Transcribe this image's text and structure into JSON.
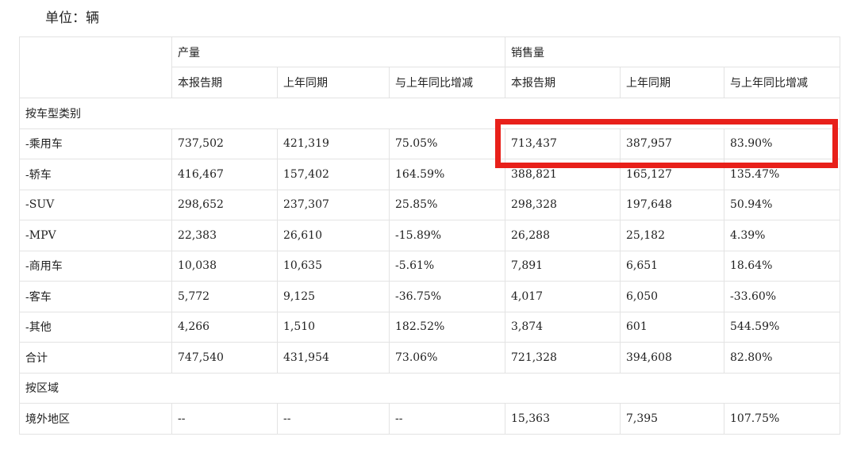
{
  "unit_label": "单位：辆",
  "header": {
    "group_production": "产量",
    "group_sales": "销售量",
    "sub": [
      "本报告期",
      "上年同期",
      "与上年同比增减",
      "本报告期",
      "上年同期",
      "与上年同比增减"
    ]
  },
  "sections": [
    {
      "title": "按车型类别",
      "rows": [
        {
          "label": "-乘用车",
          "cells": [
            "737,502",
            "421,319",
            "75.05%",
            "713,437",
            "387,957",
            "83.90%"
          ]
        },
        {
          "label": "-轿车",
          "cells": [
            "416,467",
            "157,402",
            "164.59%",
            "388,821",
            "165,127",
            "135.47%"
          ]
        },
        {
          "label": "-SUV",
          "cells": [
            "298,652",
            "237,307",
            "25.85%",
            "298,328",
            "197,648",
            "50.94%"
          ]
        },
        {
          "label": "-MPV",
          "cells": [
            "22,383",
            "26,610",
            "-15.89%",
            "26,288",
            "25,182",
            "4.39%"
          ]
        },
        {
          "label": "-商用车",
          "cells": [
            "10,038",
            "10,635",
            "-5.61%",
            "7,891",
            "6,651",
            "18.64%"
          ]
        },
        {
          "label": "-客车",
          "cells": [
            "5,772",
            "9,125",
            "-36.75%",
            "4,017",
            "6,050",
            "-33.60%"
          ]
        },
        {
          "label": "-其他",
          "cells": [
            "4,266",
            "1,510",
            "182.52%",
            "3,874",
            "601",
            "544.59%"
          ]
        },
        {
          "label": "合计",
          "cells": [
            "747,540",
            "431,954",
            "73.06%",
            "721,328",
            "394,608",
            "82.80%"
          ]
        }
      ]
    },
    {
      "title": "按区域",
      "rows": [
        {
          "label": "境外地区",
          "cells": [
            "--",
            "--",
            "--",
            "15,363",
            "7,395",
            "107.75%"
          ]
        }
      ]
    }
  ]
}
